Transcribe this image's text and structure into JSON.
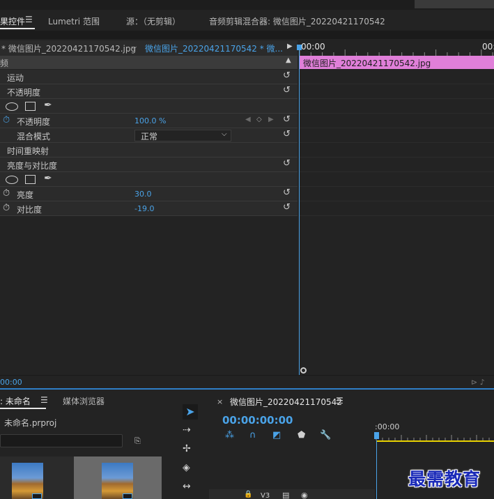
{
  "tabs": {
    "effect_controls": "果控件",
    "effect_menu": "☰",
    "lumetri": "Lumetri 范围",
    "source": "源：（无剪辑）",
    "audio_mixer": "音频剪辑混合器: 微信图片_20220421170542"
  },
  "clip_bar": {
    "master": "* 微信图片_20220421170542.jpg",
    "chevron": "⌵",
    "sequence": "微信图片_20220421170542 * 微...",
    "play": "▶"
  },
  "section": {
    "label": "频",
    "collapse": "▲"
  },
  "effects": {
    "motion": "运动",
    "opacity_group": "不透明度",
    "opacity_param": "不透明度",
    "opacity_value": "100.0 %",
    "blend_mode_label": "混合模式",
    "blend_mode_value": "正常",
    "time_remap": "时间重映射",
    "brightness_contrast": "亮度与对比度",
    "brightness_label": "亮度",
    "brightness_value": "30.0",
    "contrast_label": "对比度",
    "contrast_value": "-19.0"
  },
  "timeline": {
    "start": "00:00",
    "end": "00:",
    "clip_label": "微信图片_20220421170542.jpg",
    "clip_color": "#e07fd9"
  },
  "time_strip": {
    "left": "00:00",
    "right": "⊳ ♪"
  },
  "project": {
    "tab": ": 未命名",
    "tab_menu": "☰",
    "media_browser": "媒体浏览器",
    "file": "未命名.prproj",
    "bin_icon": "⎘"
  },
  "sequence": {
    "close": "×",
    "title": "微信图片_20220421170542",
    "menu": "☰",
    "timecode": "00:00:00:00",
    "ruler_label": ":00:00",
    "track": "V3"
  },
  "watermark": "最需教育",
  "colors": {
    "accent": "#4aa3e8",
    "clip_pink": "#e07fd9",
    "in_out_yellow": "#e8d100"
  }
}
